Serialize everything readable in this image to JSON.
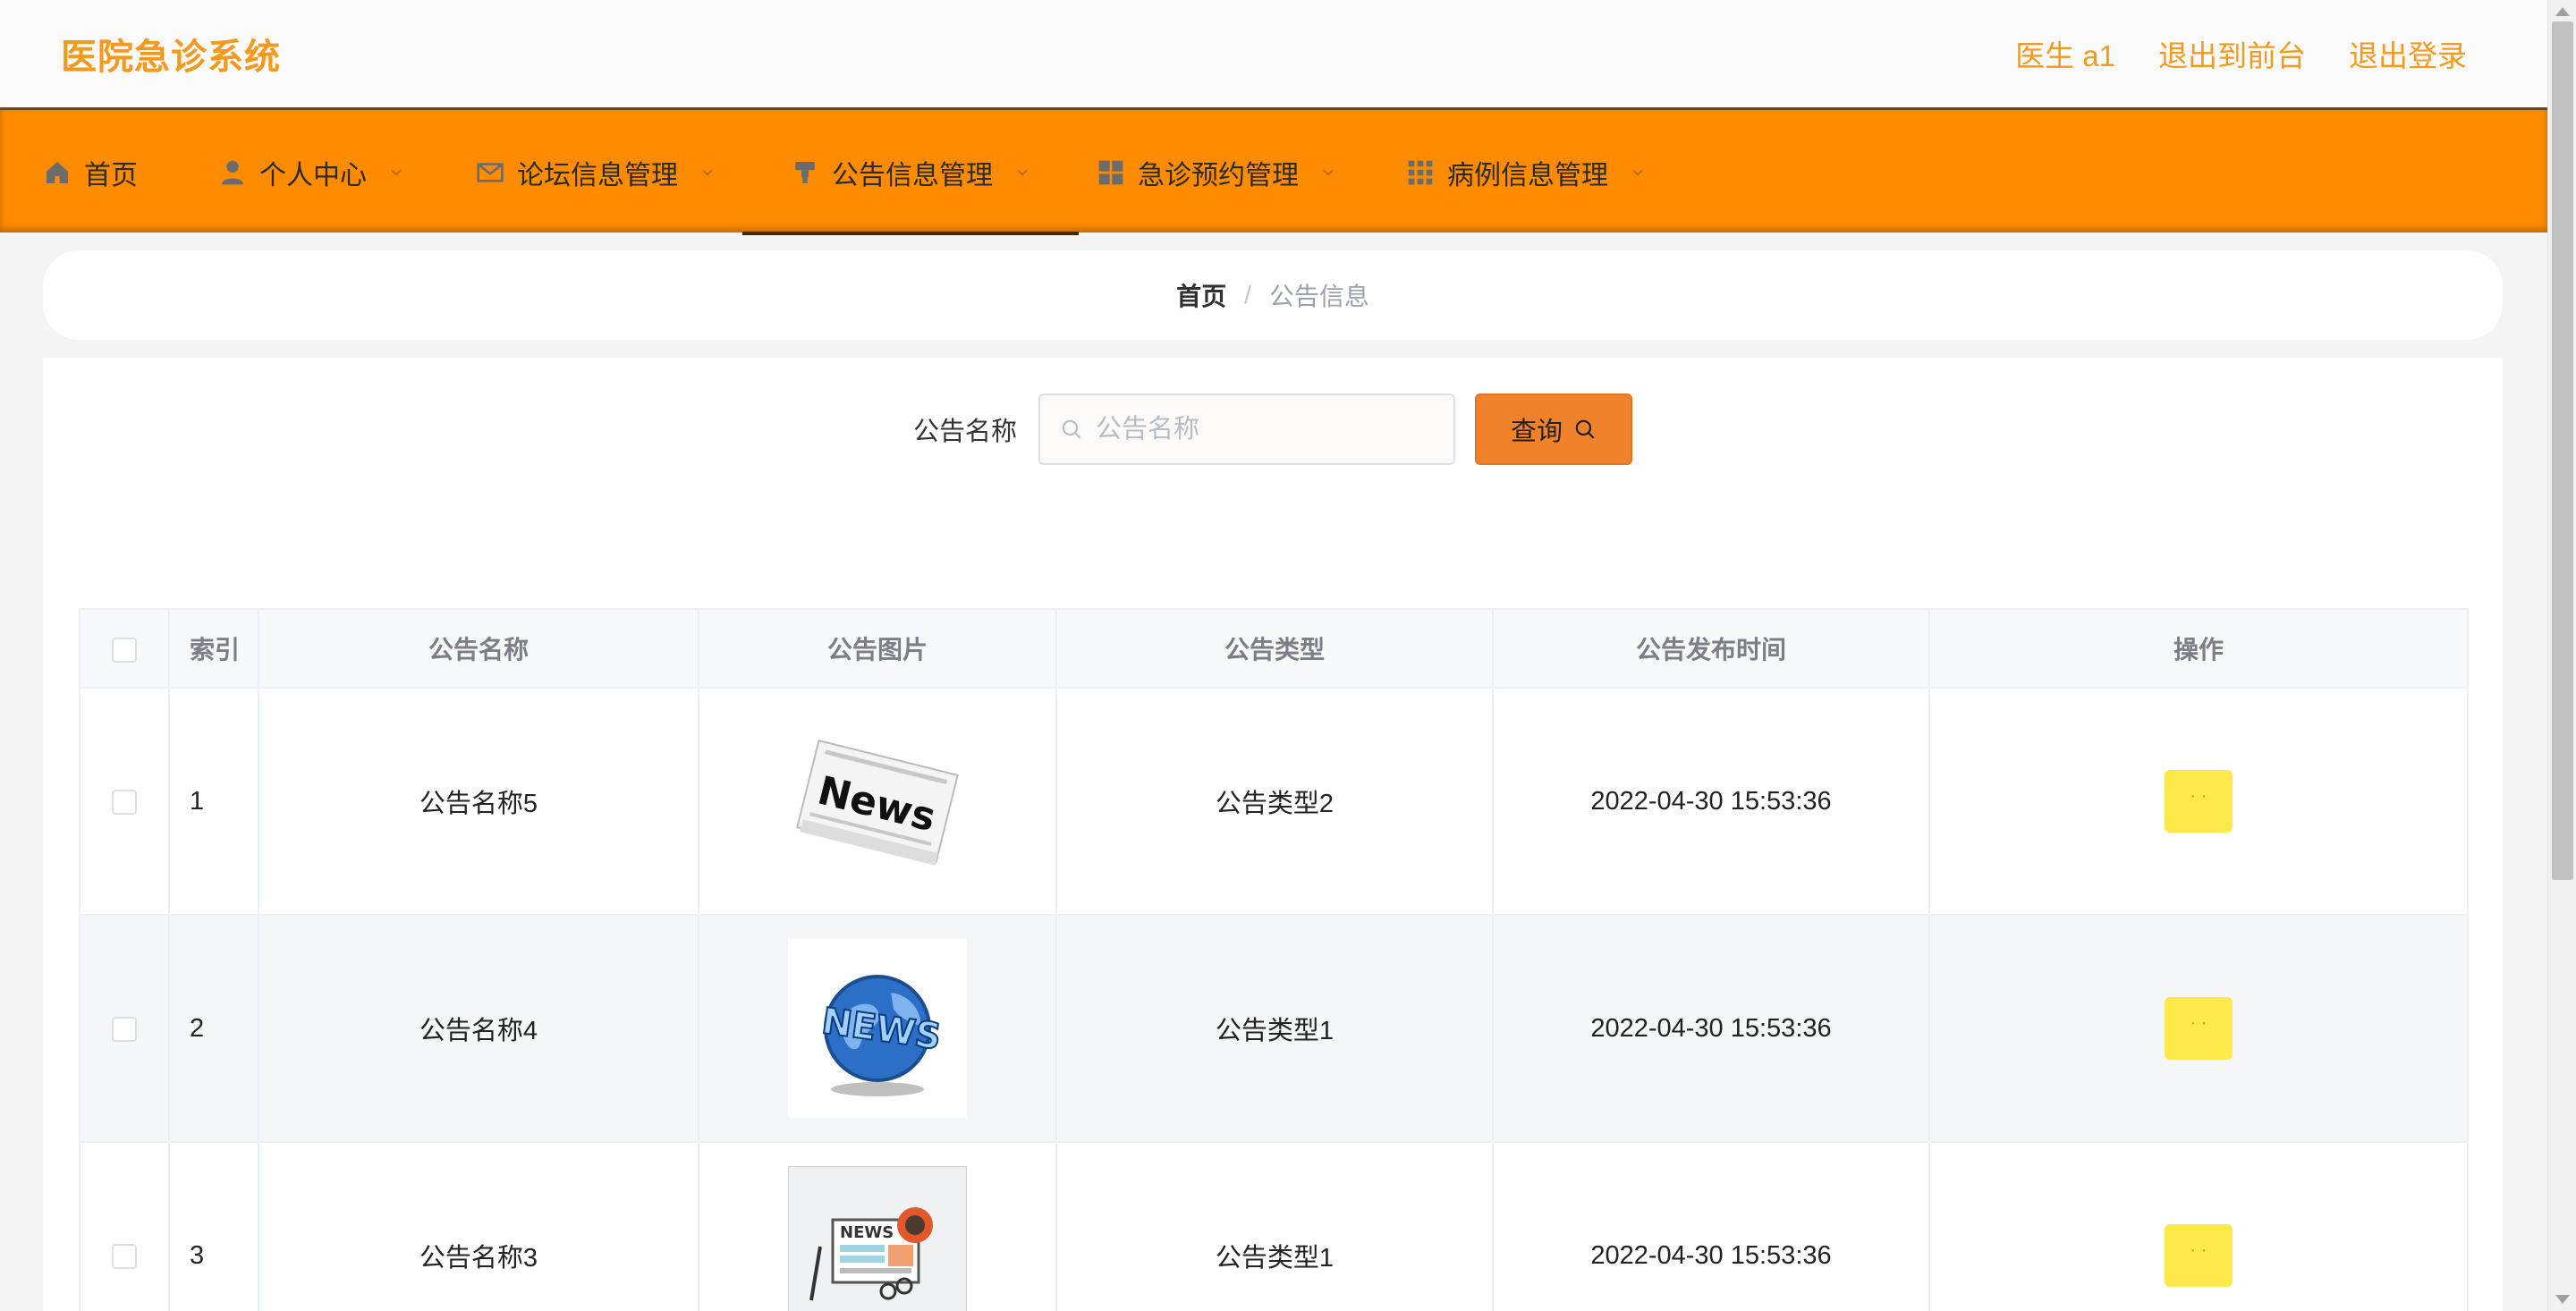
{
  "header": {
    "title": "医院急诊系统",
    "user": "医生 a1",
    "exit_front": "退出到前台",
    "logout": "退出登录"
  },
  "nav": {
    "items": [
      {
        "label": "首页",
        "icon": "home-icon"
      },
      {
        "label": "个人中心",
        "icon": "user-icon"
      },
      {
        "label": "论坛信息管理",
        "icon": "mail-icon"
      },
      {
        "label": "公告信息管理",
        "icon": "trophy-icon"
      },
      {
        "label": "急诊预约管理",
        "icon": "grid-icon"
      },
      {
        "label": "病例信息管理",
        "icon": "table-icon"
      }
    ],
    "active_index": 3
  },
  "breadcrumb": {
    "home": "首页",
    "separator": "/",
    "current": "公告信息"
  },
  "search": {
    "label": "公告名称",
    "placeholder": "公告名称",
    "button": "查询"
  },
  "table": {
    "headers": [
      "索引",
      "公告名称",
      "公告图片",
      "公告类型",
      "公告发布时间",
      "操作"
    ],
    "rows": [
      {
        "index": "1",
        "name": "公告名称5",
        "image": "newspaper-news-image",
        "type": "公告类型2",
        "time": "2022-04-30 15:53:36"
      },
      {
        "index": "2",
        "name": "公告名称4",
        "image": "globe-news-image",
        "type": "公告类型1",
        "time": "2022-04-30 15:53:36"
      },
      {
        "index": "3",
        "name": "公告名称3",
        "image": "news-illustration-image",
        "type": "公告类型1",
        "time": "2022-04-30 15:53:36"
      }
    ]
  },
  "colors": {
    "nav_bg": "#ff8c00",
    "title": "#f39a1e",
    "query_button": "#f0822c",
    "op_button": "#ffe84a"
  }
}
